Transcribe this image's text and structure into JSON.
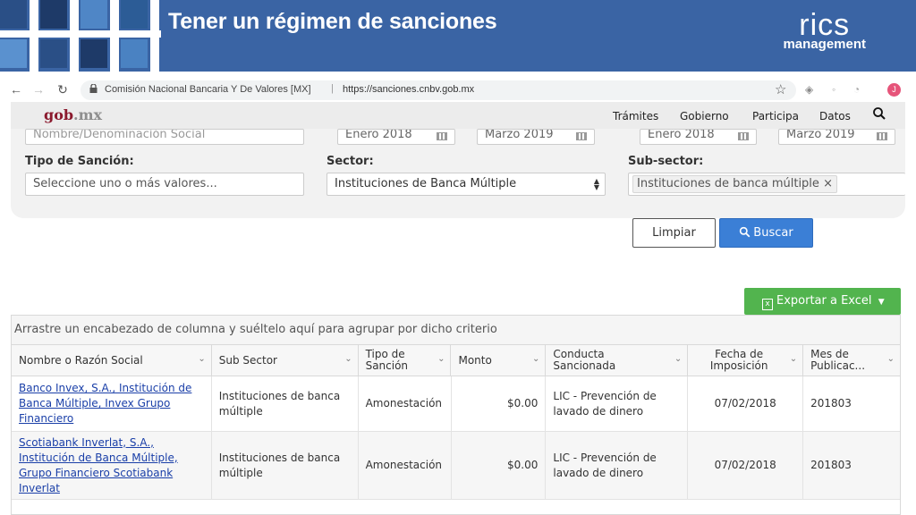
{
  "slide": {
    "title": "Tener un régimen de sanciones",
    "logo_top": "rics",
    "logo_bottom": "management"
  },
  "browser": {
    "site_name": "Comisión Nacional Bancaria Y De Valores [MX]",
    "separator": "|",
    "url": "https://sanciones.cnbv.gob.mx",
    "profile_initial": "J"
  },
  "nav": {
    "logo_main": "gob",
    "logo_suffix": ".mx",
    "items": [
      "Trámites",
      "Gobierno",
      "Participa",
      "Datos"
    ]
  },
  "filters": {
    "name_placeholder": "Nombre/Denominación Social",
    "dates": [
      "Enero 2018",
      "Marzo 2019",
      "Enero 2018",
      "Marzo 2019"
    ],
    "tipo_label": "Tipo de Sanción:",
    "tipo_placeholder": "Seleccione uno o más valores...",
    "sector_label": "Sector:",
    "sector_value": "Instituciones de Banca Múltiple",
    "subsector_label": "Sub-sector:",
    "subsector_tag": "Instituciones de banca múltiple",
    "tag_remove": "×"
  },
  "buttons": {
    "clear": "Limpiar",
    "search": "Buscar",
    "export": "Exportar a Excel"
  },
  "grid": {
    "group_hint": "Arrastre un encabezado de columna y suéltelo aquí para agrupar por dicho criterio",
    "headers": [
      "Nombre o Razón Social",
      "Sub Sector",
      "Tipo de Sanción",
      "Monto",
      "Conducta Sancionada",
      "Fecha de Imposición",
      "Mes de Publicac..."
    ],
    "rows": [
      [
        "Banco Invex, S.A., Institución de Banca Múltiple, Invex Grupo Financiero",
        "Instituciones de banca múltiple",
        "Amonestación",
        "$0.00",
        "LIC - Prevención de lavado de dinero",
        "07/02/2018",
        "201803"
      ],
      [
        "Scotiabank Inverlat, S.A., Institución de Banca Múltiple, Grupo Financiero Scotiabank Inverlat",
        "Instituciones de banca múltiple",
        "Amonestación",
        "$0.00",
        "LIC - Prevención de lavado de dinero",
        "07/02/2018",
        "201803"
      ]
    ]
  },
  "colors": {
    "header_blue": "#3a64a4",
    "gob_maroon": "#8b1a2e",
    "search_blue": "#3b7fd6",
    "excel_green": "#52b44e"
  }
}
